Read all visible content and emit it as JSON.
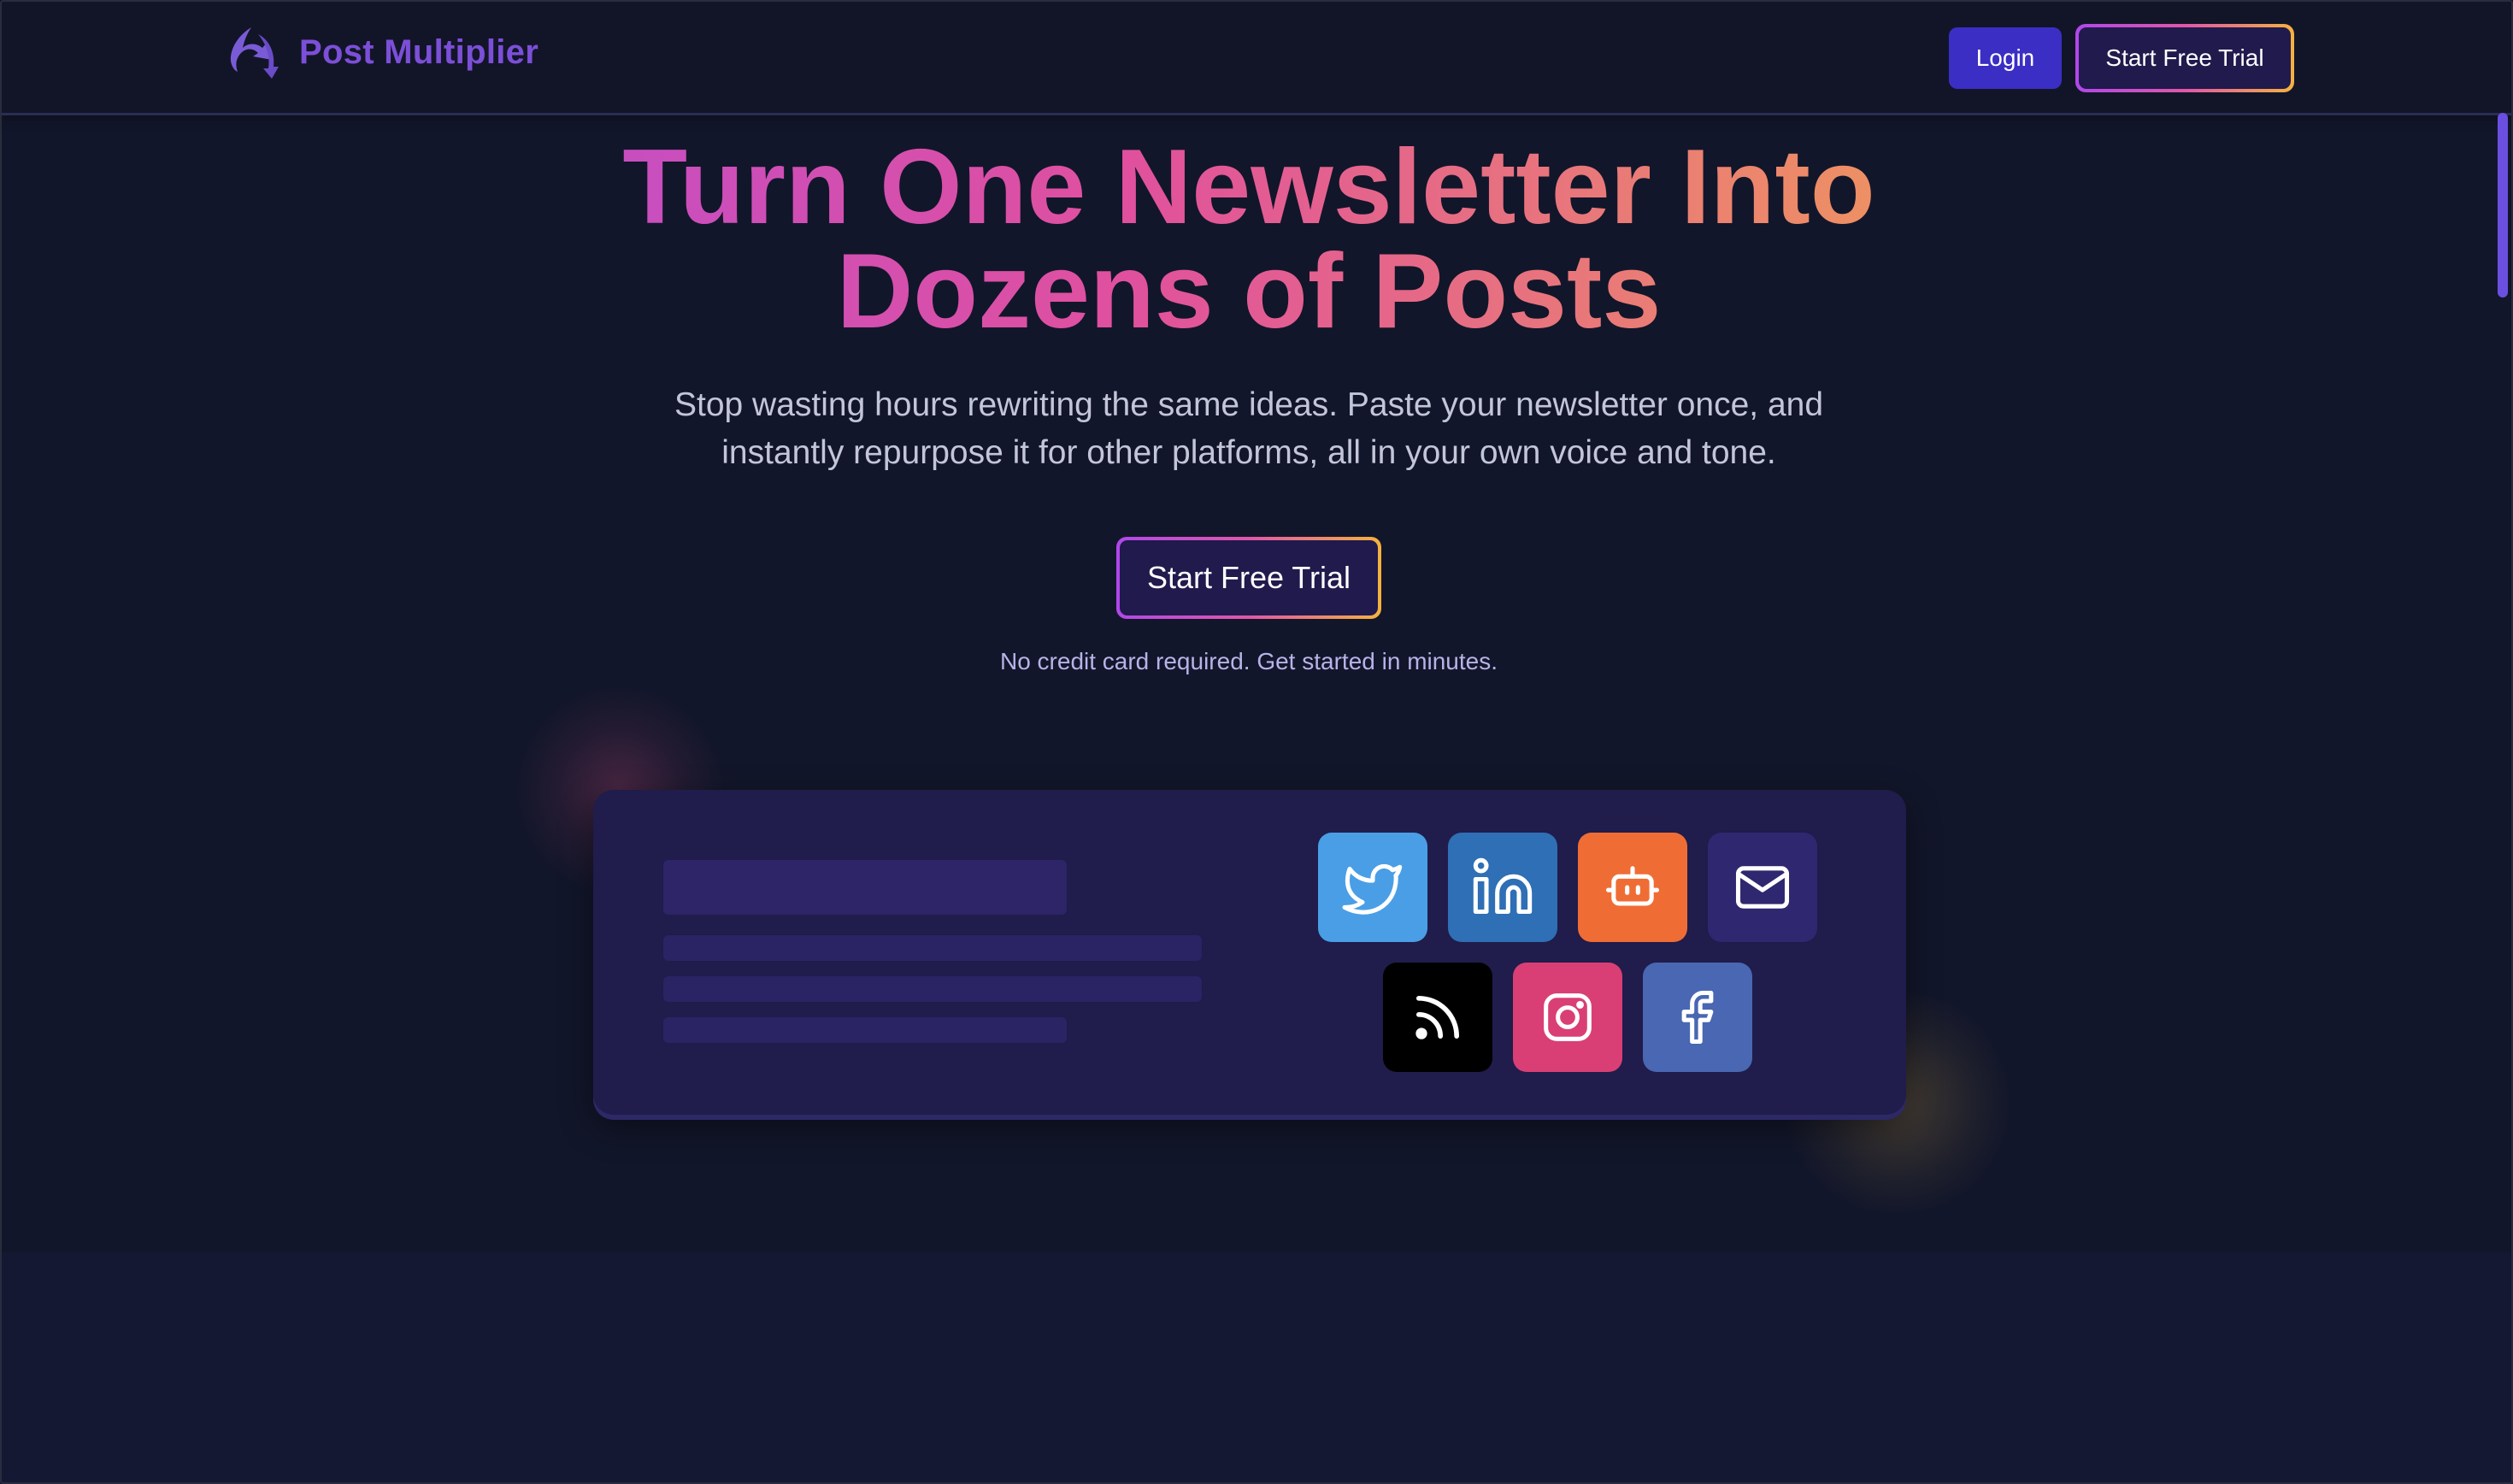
{
  "brand": {
    "name": "Post Multiplier",
    "accent": "#7c4fd8",
    "logo_icon": "swirl-arrow-logo-icon"
  },
  "header": {
    "login_label": "Login",
    "trial_label": "Start Free Trial"
  },
  "hero": {
    "headline_line1": "Turn One Newsletter Into",
    "headline_line2": "Dozens of Posts",
    "subtitle": "Stop wasting hours rewriting the same ideas. Paste your newsletter once, and instantly repurpose it for other platforms, all in your own voice and tone.",
    "cta_label": "Start Free Trial",
    "note": "No credit card required. Get started in minutes."
  },
  "platforms": [
    {
      "icon": "twitter-icon",
      "color": "#4a9ee6"
    },
    {
      "icon": "linkedin-icon",
      "color": "#2e6fb5"
    },
    {
      "icon": "robot-icon",
      "color": "#ef6d35"
    },
    {
      "icon": "mail-icon",
      "color": "#2f2770"
    },
    {
      "icon": "rss-icon",
      "color": "#000000"
    },
    {
      "icon": "instagram-icon",
      "color": "#d93f74"
    },
    {
      "icon": "facebook-icon",
      "color": "#4967b2"
    }
  ],
  "colors": {
    "background": "#12162a",
    "card": "#201c4b",
    "gradient_start": "#a94bea",
    "gradient_mid": "#e0509e",
    "gradient_end": "#f6c35a",
    "login_button": "#3b2ec4"
  }
}
